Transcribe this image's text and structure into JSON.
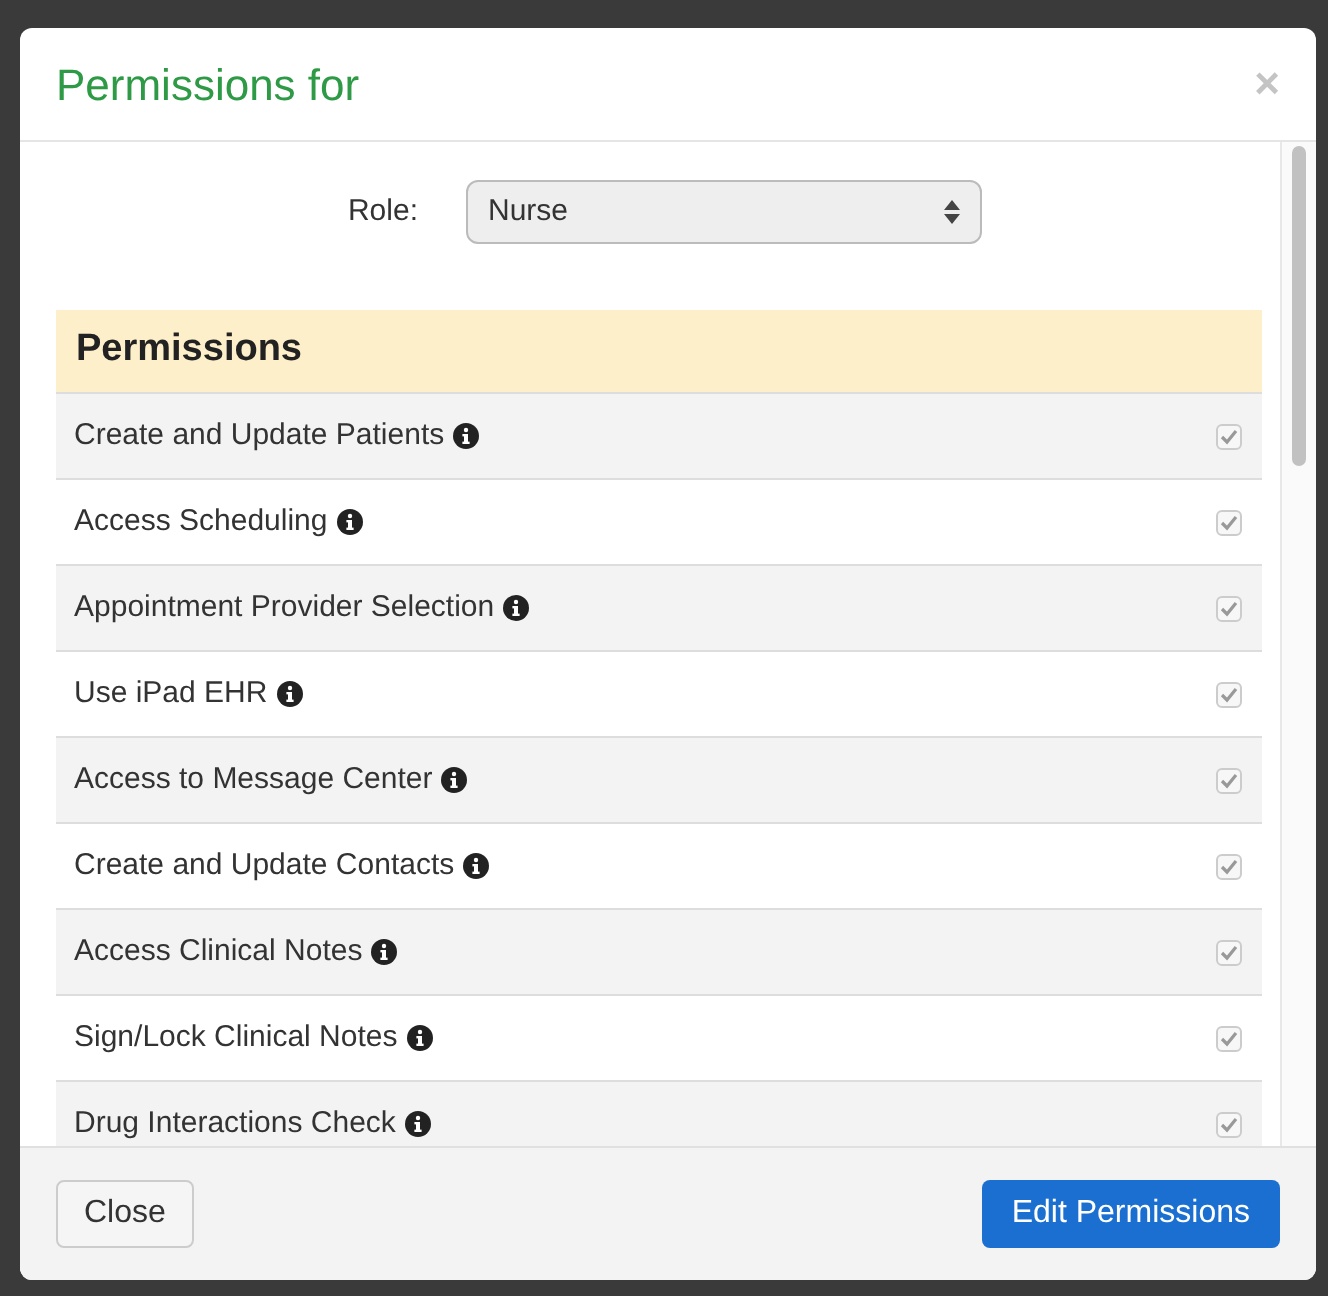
{
  "dialog": {
    "title": "Permissions for",
    "close_symbol": "×"
  },
  "role": {
    "label": "Role:",
    "value": "Nurse"
  },
  "permissions": {
    "heading": "Permissions",
    "rows": [
      {
        "label": "Create and Update Patients",
        "checked": true,
        "disabled": true
      },
      {
        "label": "Access Scheduling",
        "checked": true,
        "disabled": true
      },
      {
        "label": "Appointment Provider Selection",
        "checked": true,
        "disabled": true
      },
      {
        "label": "Use iPad EHR",
        "checked": true,
        "disabled": true
      },
      {
        "label": "Access to Message Center",
        "checked": true,
        "disabled": true
      },
      {
        "label": "Create and Update Contacts",
        "checked": true,
        "disabled": true
      },
      {
        "label": "Access Clinical Notes",
        "checked": true,
        "disabled": true
      },
      {
        "label": "Sign/Lock Clinical Notes",
        "checked": true,
        "disabled": true
      },
      {
        "label": "Drug Interactions Check",
        "checked": true,
        "disabled": true
      }
    ]
  },
  "buttons": {
    "close": "Close",
    "primary": "Edit Permissions"
  }
}
